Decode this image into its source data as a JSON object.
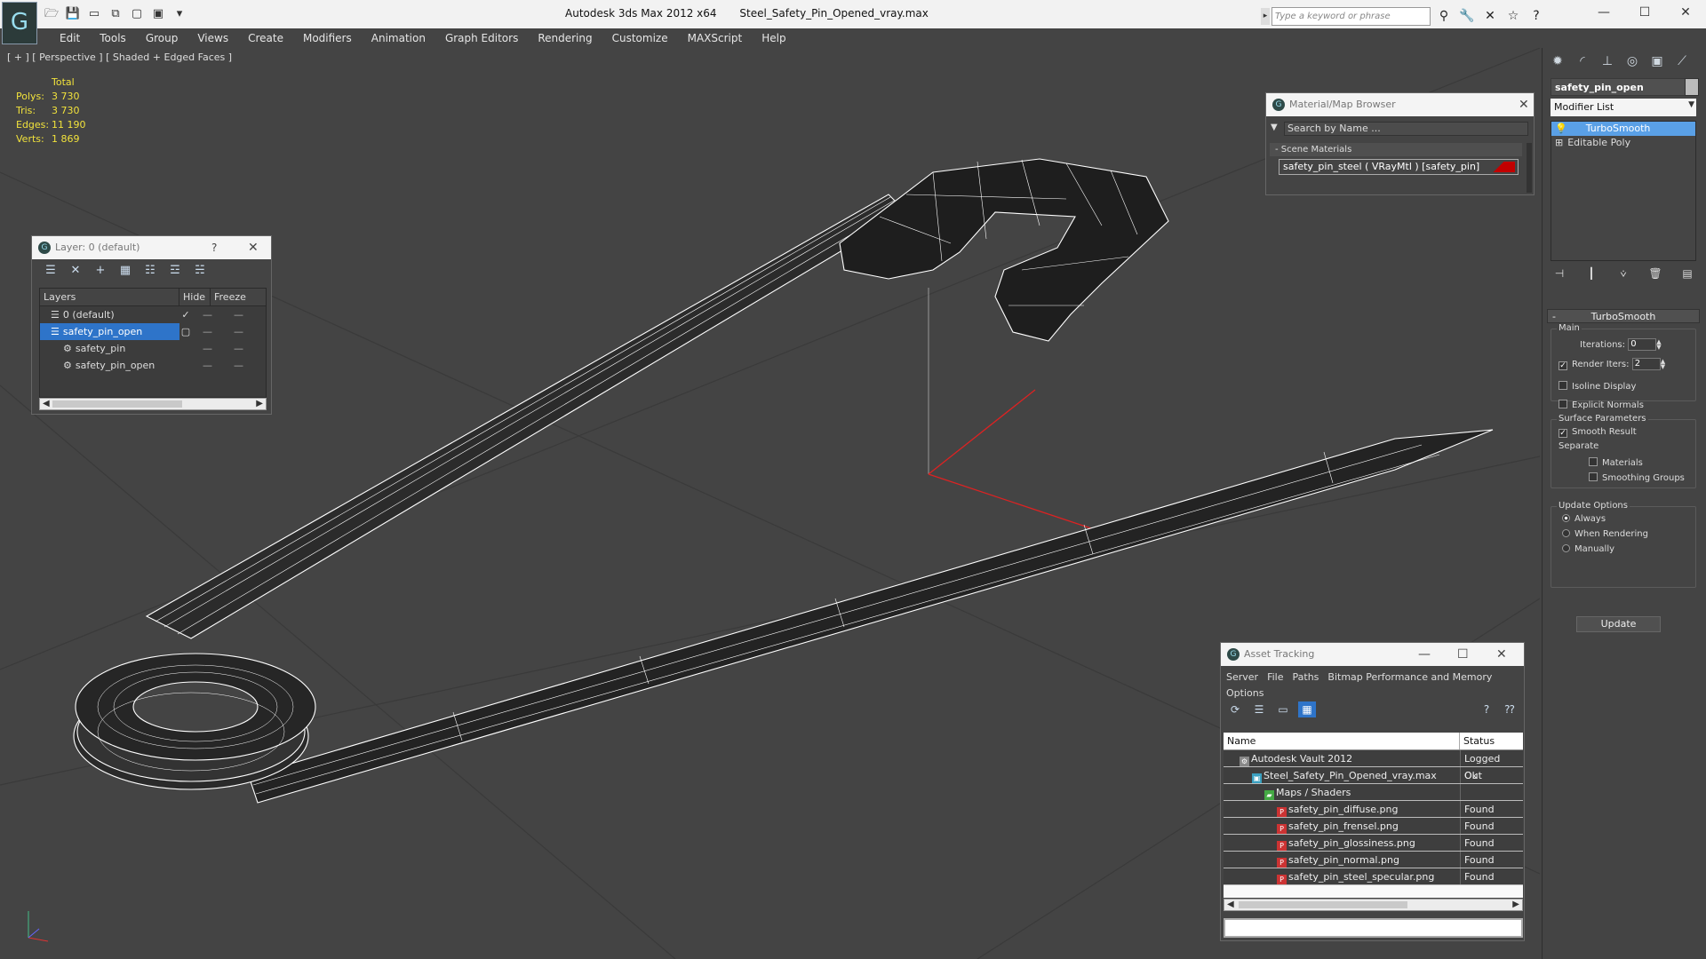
{
  "app": {
    "logo": "G",
    "title": "Autodesk 3ds Max  2012 x64",
    "file": "Steel_Safety_Pin_Opened_vray.max",
    "search_placeholder": "Type a keyword or phrase"
  },
  "menu": [
    "Edit",
    "Tools",
    "Group",
    "Views",
    "Create",
    "Modifiers",
    "Animation",
    "Graph Editors",
    "Rendering",
    "Customize",
    "MAXScript",
    "Help"
  ],
  "viewport": {
    "label": "[ + ] [ Perspective ] [ Shaded + Edged Faces ]",
    "stats": {
      "header": "Total",
      "rows": [
        {
          "k": "Polys:",
          "v": "3 730"
        },
        {
          "k": "Tris:",
          "v": "3 730"
        },
        {
          "k": "Edges:",
          "v": "11 190"
        },
        {
          "k": "Verts:",
          "v": "1 869"
        }
      ]
    }
  },
  "command_panel": {
    "object_name": "safety_pin_open",
    "modifier_list": "Modifier List",
    "stack": [
      {
        "label": "TurboSmooth",
        "selected": true
      },
      {
        "label": "Editable Poly",
        "selected": false
      }
    ],
    "turbosmooth": {
      "title": "TurboSmooth",
      "main_label": "Main",
      "iterations_label": "Iterations:",
      "iterations": "0",
      "render_iters_label": "Render Iters:",
      "render_iters": "2",
      "isoline": "Isoline Display",
      "explicit": "Explicit Normals",
      "surface_label": "Surface Parameters",
      "smooth_result": "Smooth Result",
      "separate_label": "Separate",
      "materials": "Materials",
      "smoothing_groups": "Smoothing Groups",
      "update_label": "Update Options",
      "always": "Always",
      "when_rendering": "When Rendering",
      "manually": "Manually",
      "update_button": "Update"
    }
  },
  "layer_window": {
    "title": "Layer: 0 (default)",
    "help": "?",
    "columns": [
      "Layers",
      "Hide",
      "Freeze"
    ],
    "rows": [
      {
        "name": "0 (default)",
        "indent": 0,
        "selected": false
      },
      {
        "name": "safety_pin_open",
        "indent": 0,
        "selected": true
      },
      {
        "name": "safety_pin",
        "indent": 1,
        "selected": false
      },
      {
        "name": "safety_pin_open",
        "indent": 1,
        "selected": false
      }
    ]
  },
  "material_browser": {
    "title": "Material/Map Browser",
    "search": "Search by Name ...",
    "section": "Scene Materials",
    "item": "safety_pin_steel  ( VRayMtl ) [safety_pin]"
  },
  "asset_tracking": {
    "title": "Asset Tracking",
    "menu": [
      "Server",
      "File",
      "Paths",
      "Bitmap Performance and Memory",
      "Options"
    ],
    "columns": [
      "Name",
      "Status"
    ],
    "rows": [
      {
        "name": "Autodesk Vault 2012",
        "status": "Logged Out",
        "indent": 1,
        "icon": "vault"
      },
      {
        "name": "Steel_Safety_Pin_Opened_vray.max",
        "status": "Ok",
        "indent": 2,
        "icon": "max"
      },
      {
        "name": "Maps / Shaders",
        "status": "",
        "indent": 3,
        "icon": "folder"
      },
      {
        "name": "safety_pin_diffuse.png",
        "status": "Found",
        "indent": 4,
        "icon": "png"
      },
      {
        "name": "safety_pin_frensel.png",
        "status": "Found",
        "indent": 4,
        "icon": "png"
      },
      {
        "name": "safety_pin_glossiness.png",
        "status": "Found",
        "indent": 4,
        "icon": "png"
      },
      {
        "name": "safety_pin_normal.png",
        "status": "Found",
        "indent": 4,
        "icon": "png"
      },
      {
        "name": "safety_pin_steel_specular.png",
        "status": "Found",
        "indent": 4,
        "icon": "png"
      }
    ]
  }
}
